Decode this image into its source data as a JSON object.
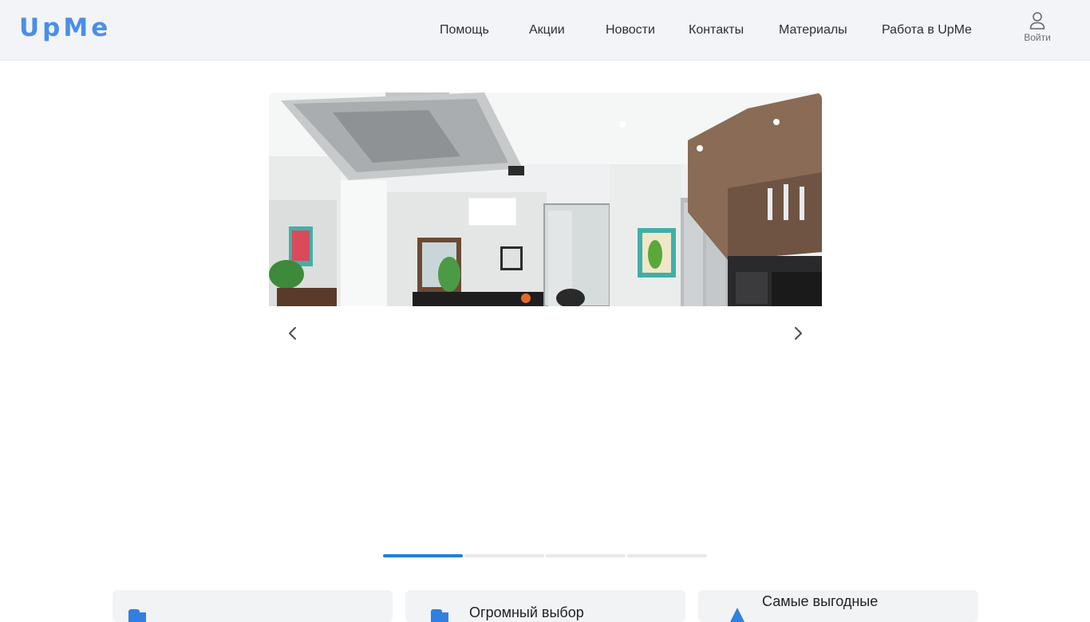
{
  "header": {
    "logo": "UpMe",
    "nav": [
      {
        "id": "help",
        "label": "Помощь"
      },
      {
        "id": "promo",
        "label": "Акции"
      },
      {
        "id": "news",
        "label": "Новости"
      },
      {
        "id": "contacts",
        "label": "Контакты"
      },
      {
        "id": "materials",
        "label": "Материалы"
      },
      {
        "id": "jobs",
        "label": "Работа в UpMe"
      }
    ],
    "login_label": "Войти"
  },
  "slider": {
    "active_slide": 1,
    "slide_count": 4
  },
  "features": [
    {
      "title": ""
    },
    {
      "title": "Огромный выбор"
    },
    {
      "title": "Самые выгодные"
    }
  ],
  "colors": {
    "accent": "#1f7fd8",
    "logo": "#4a8fe7",
    "header_bg": "#f3f4f7"
  }
}
